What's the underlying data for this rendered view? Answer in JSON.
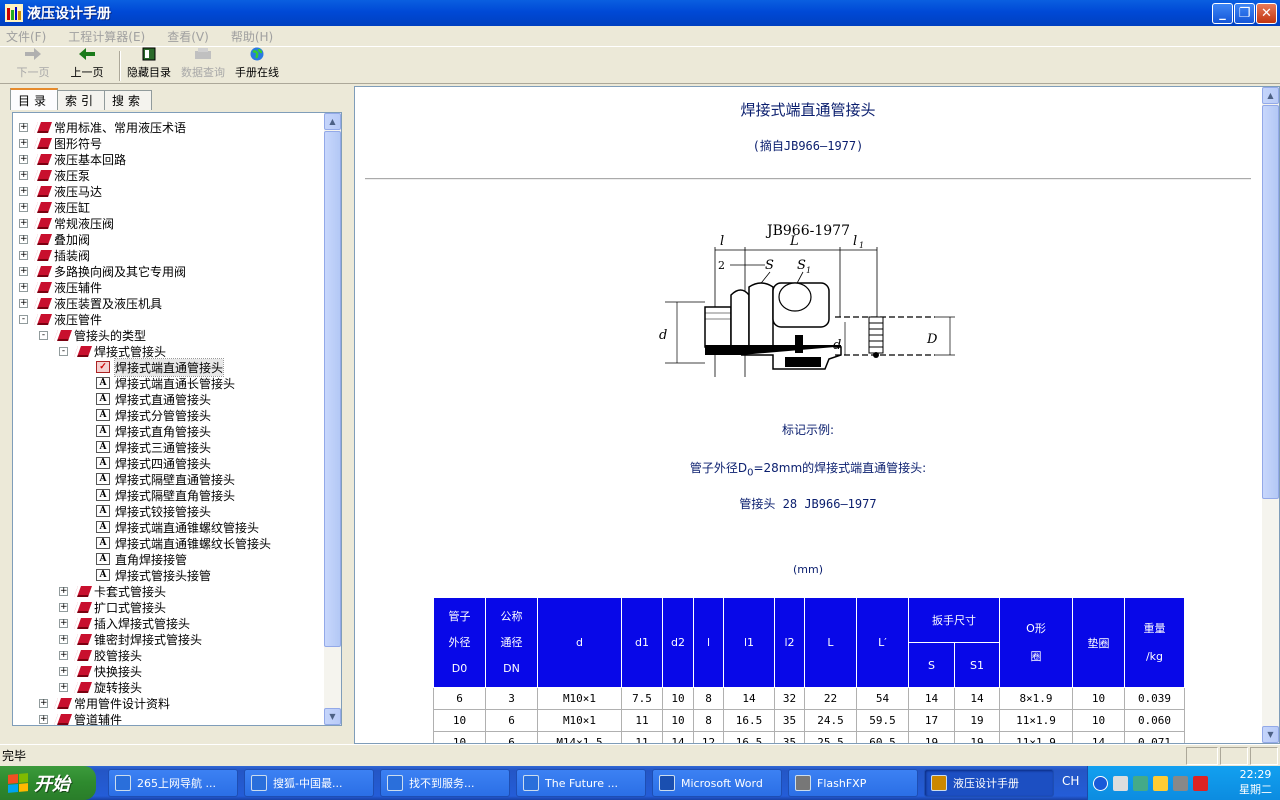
{
  "window": {
    "title": "液压设计手册"
  },
  "menu": [
    {
      "label": "文件(F)"
    },
    {
      "label": "工程计算器(E)"
    },
    {
      "label": "查看(V)"
    },
    {
      "label": "帮助(H)"
    }
  ],
  "toolbar": {
    "next": "下一页",
    "prev": "上一页",
    "hide_toc": "隐藏目录",
    "data_query": "数据查询",
    "online": "手册在线"
  },
  "tabs": [
    "目录",
    "索引",
    "搜索"
  ],
  "tree": [
    {
      "label": "常用标准、常用液压术语",
      "level": 0,
      "type": "book",
      "exp": "+"
    },
    {
      "label": "图形符号",
      "level": 0,
      "type": "book",
      "exp": "+"
    },
    {
      "label": "液压基本回路",
      "level": 0,
      "type": "book",
      "exp": "+"
    },
    {
      "label": "液压泵",
      "level": 0,
      "type": "book",
      "exp": "+"
    },
    {
      "label": "液压马达",
      "level": 0,
      "type": "book",
      "exp": "+"
    },
    {
      "label": "液压缸",
      "level": 0,
      "type": "book",
      "exp": "+"
    },
    {
      "label": "常规液压阀",
      "level": 0,
      "type": "book",
      "exp": "+"
    },
    {
      "label": "叠加阀",
      "level": 0,
      "type": "book",
      "exp": "+"
    },
    {
      "label": "插装阀",
      "level": 0,
      "type": "book",
      "exp": "+"
    },
    {
      "label": "多路换向阀及其它专用阀",
      "level": 0,
      "type": "book",
      "exp": "+"
    },
    {
      "label": "液压辅件",
      "level": 0,
      "type": "book",
      "exp": "+"
    },
    {
      "label": "液压装置及液压机具",
      "level": 0,
      "type": "book",
      "exp": "+"
    },
    {
      "label": "液压管件",
      "level": 0,
      "type": "book",
      "exp": "-"
    },
    {
      "label": "管接头的类型",
      "level": 1,
      "type": "book",
      "exp": "-"
    },
    {
      "label": "焊接式管接头",
      "level": 2,
      "type": "book",
      "exp": "-"
    },
    {
      "label": "焊接式端直通管接头",
      "level": 3,
      "type": "page",
      "selected": true
    },
    {
      "label": "焊接式端直通长管接头",
      "level": 3,
      "type": "page"
    },
    {
      "label": "焊接式直通管接头",
      "level": 3,
      "type": "page"
    },
    {
      "label": "焊接式分管管接头",
      "level": 3,
      "type": "page"
    },
    {
      "label": "焊接式直角管接头",
      "level": 3,
      "type": "page"
    },
    {
      "label": "焊接式三通管接头",
      "level": 3,
      "type": "page"
    },
    {
      "label": "焊接式四通管接头",
      "level": 3,
      "type": "page"
    },
    {
      "label": "焊接式隔壁直通管接头",
      "level": 3,
      "type": "page"
    },
    {
      "label": "焊接式隔壁直角管接头",
      "level": 3,
      "type": "page"
    },
    {
      "label": "焊接式铰接管接头",
      "level": 3,
      "type": "page"
    },
    {
      "label": "焊接式端直通锥螺纹管接头",
      "level": 3,
      "type": "page"
    },
    {
      "label": "焊接式端直通锥螺纹长管接头",
      "level": 3,
      "type": "page"
    },
    {
      "label": "直角焊接接管",
      "level": 3,
      "type": "page"
    },
    {
      "label": "焊接式管接头接管",
      "level": 3,
      "type": "page"
    },
    {
      "label": "卡套式管接头",
      "level": 2,
      "type": "book",
      "exp": "+"
    },
    {
      "label": "扩口式管接头",
      "level": 2,
      "type": "book",
      "exp": "+"
    },
    {
      "label": "插入焊接式管接头",
      "level": 2,
      "type": "book",
      "exp": "+"
    },
    {
      "label": "锥密封焊接式管接头",
      "level": 2,
      "type": "book",
      "exp": "+"
    },
    {
      "label": "胶管接头",
      "level": 2,
      "type": "book",
      "exp": "+"
    },
    {
      "label": "快换接头",
      "level": 2,
      "type": "book",
      "exp": "+"
    },
    {
      "label": "旋转接头",
      "level": 2,
      "type": "book",
      "exp": "+"
    },
    {
      "label": "常用管件设计资料",
      "level": 1,
      "type": "book",
      "exp": "+"
    },
    {
      "label": "管道辅件",
      "level": 1,
      "type": "book",
      "exp": "+"
    }
  ],
  "doc": {
    "title": "焊接式端直通管接头",
    "source": "(摘自JB966—1977)",
    "figure": {
      "standard": "JB966-1977",
      "labels": [
        "l",
        "L",
        "l1",
        "2",
        "S",
        "S1",
        "d",
        "d1",
        "D0"
      ]
    },
    "mark_heading": "标记示例:",
    "mark_desc_pre": "管子外径D",
    "mark_desc_sub": "0",
    "mark_desc_post": "=28mm的焊接式端直通管接头:",
    "mark_code": "管接头 28 JB966—1977",
    "unit": "(mm)"
  },
  "table": {
    "headers": {
      "od": [
        "管子",
        "外径",
        "D0"
      ],
      "dn": [
        "公称",
        "通径",
        "DN"
      ],
      "d": "d",
      "d1": "d1",
      "d2": "d2",
      "l": "l",
      "l1": "l1",
      "l2": "l2",
      "L": "L",
      "Lp": "L′",
      "wrench": "扳手尺寸",
      "S": "S",
      "S1": "S1",
      "oring": [
        "O形",
        "圈"
      ],
      "washer": "垫圈",
      "weight": [
        "重量",
        "/kg"
      ]
    },
    "rows": [
      [
        "6",
        "3",
        "M10×1",
        "7.5",
        "10",
        "8",
        "14",
        "32",
        "22",
        "54",
        "14",
        "14",
        "8×1.9",
        "10",
        "0.039"
      ],
      [
        "10",
        "6",
        "M10×1",
        "11",
        "10",
        "8",
        "16.5",
        "35",
        "24.5",
        "59.5",
        "17",
        "19",
        "11×1.9",
        "10",
        "0.060"
      ],
      [
        "10",
        "6",
        "M14×1.5",
        "11",
        "14",
        "12",
        "16.5",
        "35",
        "25.5",
        "60.5",
        "19",
        "19",
        "11×1.9",
        "14",
        "0.071"
      ]
    ]
  },
  "status": {
    "text": "完毕"
  },
  "taskbar": {
    "start": "开始",
    "tasks": [
      "265上网导航 ...",
      "搜狐-中国最...",
      "找不到服务...",
      "The Future ...",
      "Microsoft Word",
      "FlashFXP",
      "液压设计手册"
    ],
    "lang": "CH",
    "time": "22:29",
    "day": "星期二"
  },
  "colors": {
    "title_blue": "#0a1e6e",
    "table_header": "#0808e8",
    "selected_book": "#c8102e"
  }
}
